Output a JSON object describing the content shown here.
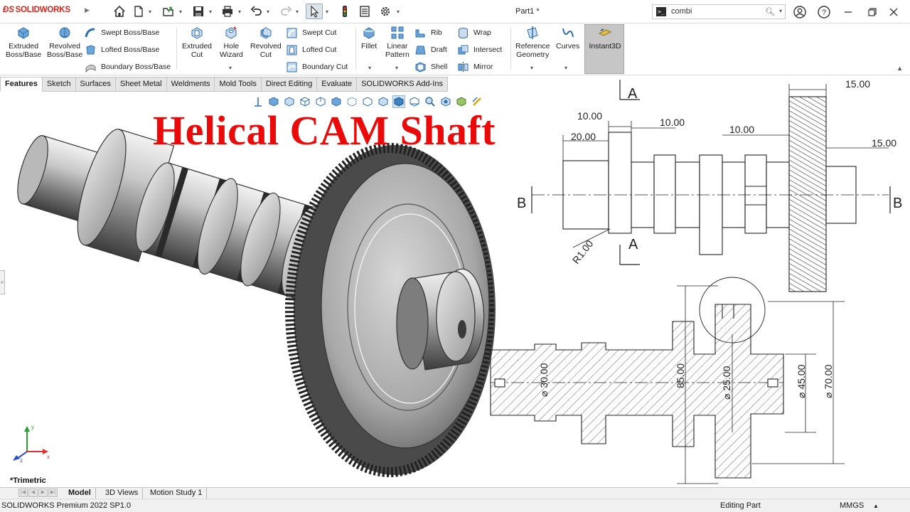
{
  "app": {
    "brand": "SOLIDWORKS",
    "document_title": "Part1 *"
  },
  "search": {
    "value": "combi"
  },
  "quick_access": [
    "home-icon",
    "new-document-icon",
    "open-icon",
    "save-icon",
    "print-icon",
    "undo-icon",
    "redo-icon",
    "select-pointer-icon",
    "rebuild-traffic-light-icon",
    "file-properties-icon",
    "options-gear-icon"
  ],
  "window_controls": [
    "user-account-icon",
    "help-icon",
    "minimize-icon",
    "restore-icon",
    "close-icon"
  ],
  "ribbon": {
    "large_buttons": [
      {
        "name": "extruded-boss-base",
        "label1": "Extruded",
        "label2": "Boss/Base"
      },
      {
        "name": "revolved-boss-base",
        "label1": "Revolved",
        "label2": "Boss/Base"
      },
      {
        "name": "extruded-cut",
        "label1": "Extruded",
        "label2": "Cut"
      },
      {
        "name": "hole-wizard",
        "label1": "Hole",
        "label2": "Wizard"
      },
      {
        "name": "revolved-cut",
        "label1": "Revolved",
        "label2": "Cut"
      },
      {
        "name": "fillet",
        "label1": "Fillet",
        "label2": ""
      },
      {
        "name": "linear-pattern",
        "label1": "Linear",
        "label2": "Pattern"
      },
      {
        "name": "reference-geometry",
        "label1": "Reference",
        "label2": "Geometry"
      },
      {
        "name": "curves",
        "label1": "Curves",
        "label2": ""
      },
      {
        "name": "instant3d",
        "label1": "Instant3D",
        "label2": ""
      }
    ],
    "small_buttons": [
      "Swept Boss/Base",
      "Lofted Boss/Base",
      "Boundary Boss/Base",
      "Swept Cut",
      "Lofted Cut",
      "Boundary Cut",
      "Rib",
      "Draft",
      "Shell",
      "Wrap",
      "Intersect",
      "Mirror"
    ]
  },
  "command_tabs": [
    "Features",
    "Sketch",
    "Surfaces",
    "Sheet Metal",
    "Weldments",
    "Mold Tools",
    "Direct Editing",
    "Evaluate",
    "SOLIDWORKS Add-Ins"
  ],
  "active_command_tab": "Features",
  "heads_up_toolbar": [
    "previous-view-icon",
    "zoom-to-fit-icon",
    "zoom-area-icon",
    "section-view-icon",
    "view-orientation-icon",
    "display-style-icon",
    "hide-show-items-icon",
    "edit-appearance-icon",
    "apply-scene-icon",
    "view-settings-icon"
  ],
  "headline": "Helical CAM Shaft",
  "drawing": {
    "dims_top": [
      "10.00",
      "10.00",
      "20.00",
      "10.00",
      "15.00",
      "15.00"
    ],
    "fillet_label": "R1.00",
    "section_labels": {
      "a_top": "A",
      "a_bottom": "A",
      "b_left": "B",
      "b_right": "B"
    },
    "section_dims": [
      "⌀ 30.00",
      "85.00",
      "⌀ 25.00",
      "⌀ 45.00",
      "⌀ 70.00"
    ]
  },
  "triad": {
    "x": "x",
    "y": "y",
    "z": "z"
  },
  "view_orientation": "*Trimetric",
  "bottom_tabs": [
    "Model",
    "3D Views",
    "Motion Study 1"
  ],
  "active_bottom_tab": "Model",
  "status": {
    "product": "SOLIDWORKS Premium 2022 SP1.0",
    "mode": "Editing Part",
    "units": "MMGS"
  },
  "colors": {
    "headline": "#ea0a0a",
    "brand_red": "#d9241b",
    "icon_blue": "#2f6fb0",
    "metal": "#9a9a9a"
  }
}
